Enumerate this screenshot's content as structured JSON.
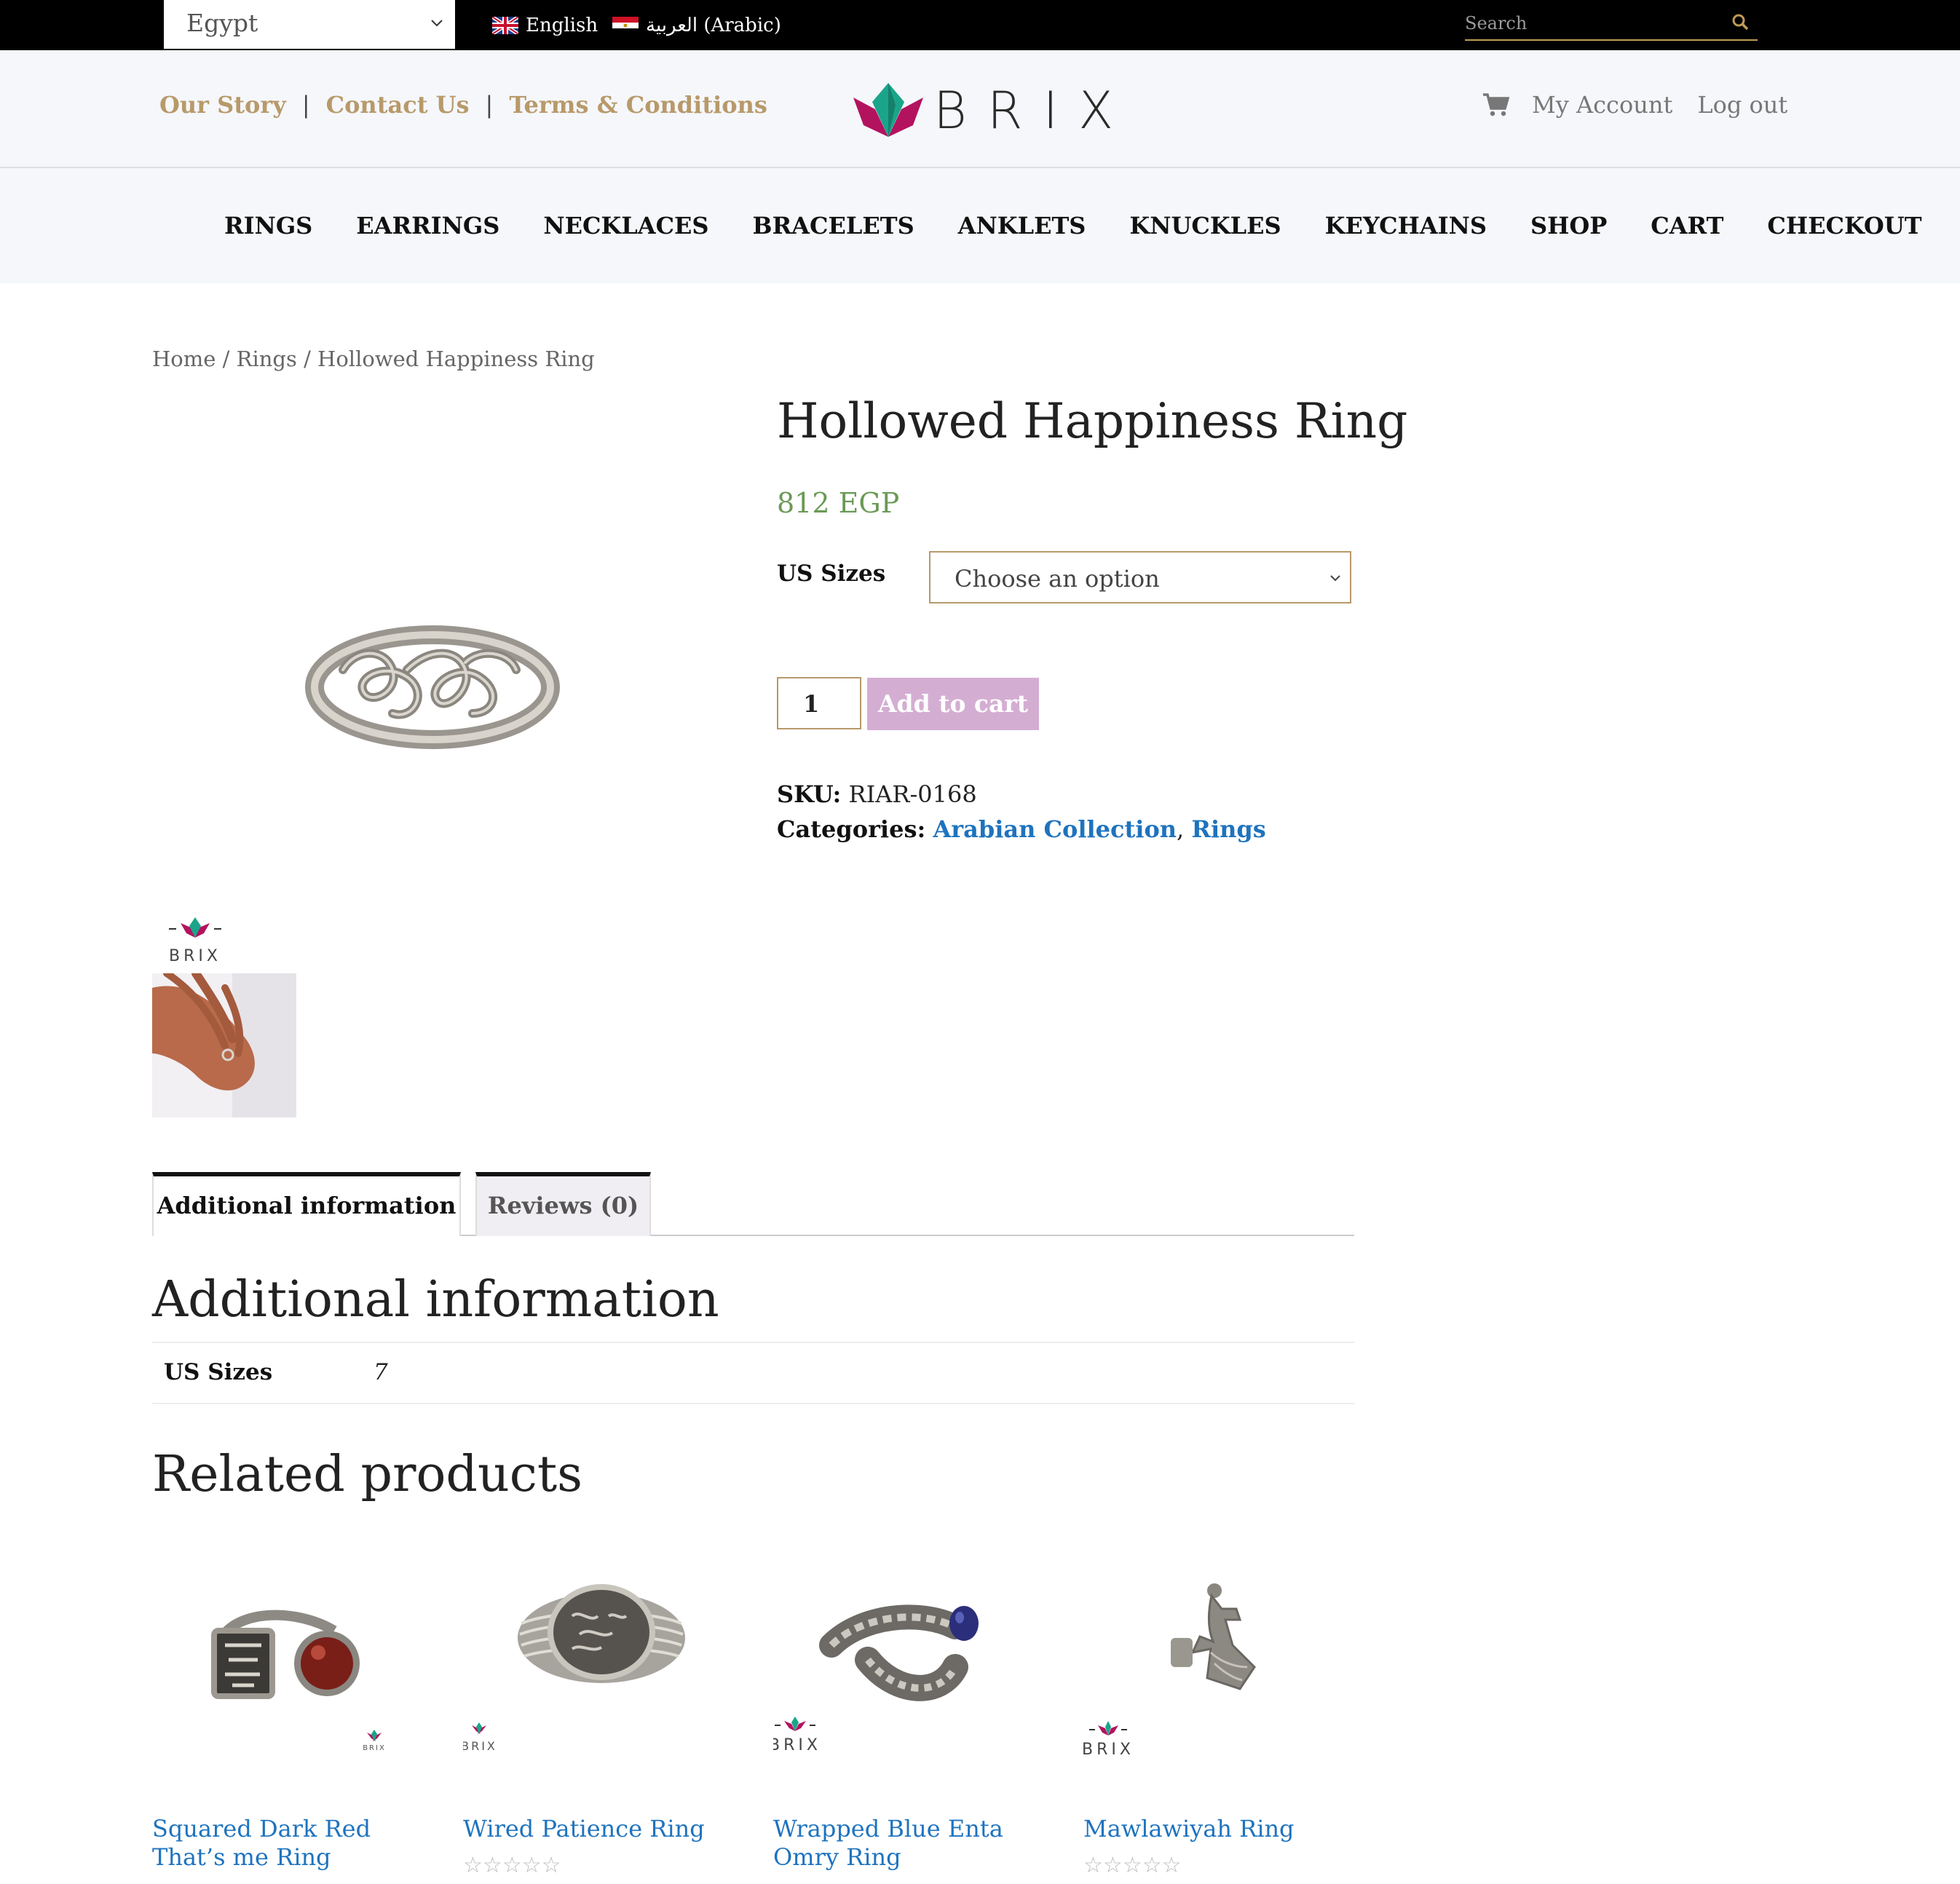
{
  "topbar": {
    "country": "Egypt",
    "languages": [
      {
        "label": "English",
        "flag": "uk-flag-icon"
      },
      {
        "label": "العربية (Arabic)",
        "flag": "egypt-flag-icon"
      }
    ],
    "search_placeholder": "Search"
  },
  "header": {
    "links": [
      "Our Story",
      "Contact Us",
      "Terms & Conditions"
    ],
    "brand": "BRIX",
    "account": {
      "my_account": "My Account",
      "logout": "Log out"
    }
  },
  "nav": [
    "RINGS",
    "EARRINGS",
    "NECKLACES",
    "BRACELETS",
    "ANKLETS",
    "KNUCKLES",
    "KEYCHAINS",
    "SHOP",
    "CART",
    "CHECKOUT"
  ],
  "breadcrumb": "Home / Rings / Hollowed Happiness Ring",
  "product": {
    "title": "Hollowed Happiness Ring",
    "price": "812 EGP",
    "size_label": "US Sizes",
    "size_placeholder": "Choose an option",
    "quantity": "1",
    "add_to_cart": "Add to cart",
    "sku_label": "SKU:",
    "sku": "RIAR-0168",
    "categories_label": "Categories:",
    "categories": [
      "Arabian Collection",
      "Rings"
    ],
    "thumb_brand": "BRIX"
  },
  "tabs": {
    "info": "Additional information",
    "reviews": "Reviews (0)"
  },
  "additional_info": {
    "heading": "Additional information",
    "rows": [
      {
        "key": "US Sizes",
        "value": "7"
      }
    ]
  },
  "related": {
    "heading": "Related products",
    "items": [
      {
        "name": "Squared Dark Red That’s me Ring",
        "rating": 0,
        "brand": "BRIX"
      },
      {
        "name": "Wired Patience Ring",
        "rating": 0,
        "brand": "BRIX"
      },
      {
        "name": "Wrapped Blue Enta Omry Ring",
        "rating": 0,
        "brand": "BRIX"
      },
      {
        "name": "Mawlawiyah Ring",
        "rating": 0,
        "brand": "BRIX"
      }
    ]
  },
  "colors": {
    "accent_gold": "#b8996a",
    "price_green": "#6a9a55",
    "link_blue": "#1e73be",
    "button_pink": "#d4aed2",
    "logo_magenta": "#b3125f",
    "logo_teal": "#1aa58a"
  }
}
